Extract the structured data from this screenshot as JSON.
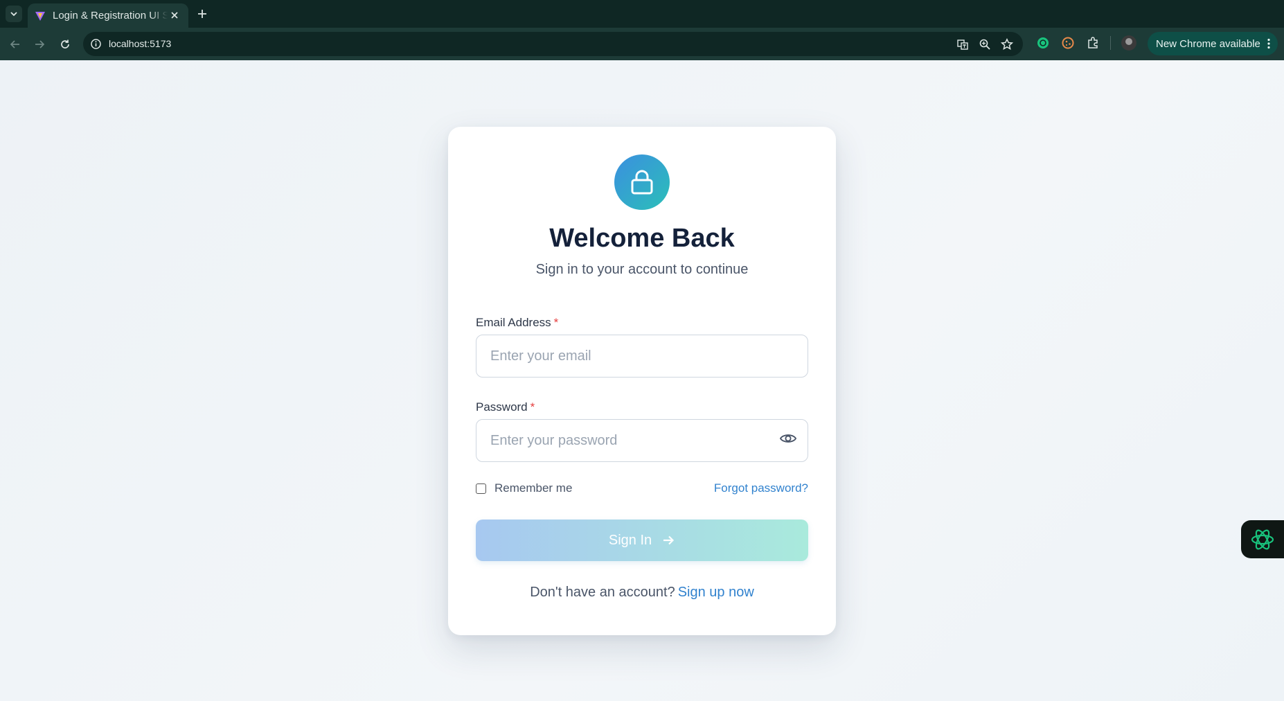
{
  "browser": {
    "tab_title": "Login & Registration UI S",
    "url": "localhost:5173",
    "update_button": "New Chrome available"
  },
  "card": {
    "title": "Welcome Back",
    "subtitle": "Sign in to your account to continue",
    "email": {
      "label": "Email Address",
      "required_mark": "*",
      "placeholder": "Enter your email",
      "value": ""
    },
    "password": {
      "label": "Password",
      "required_mark": "*",
      "placeholder": "Enter your password",
      "value": ""
    },
    "remember_label": "Remember me",
    "remember_checked": false,
    "forgot_label": "Forgot password?",
    "signin_label": "Sign In",
    "signup_prompt": "Don't have an account?",
    "signup_link": "Sign up now"
  },
  "colors": {
    "accent_blue": "#3182ce",
    "gradient_start": "#3b8fe0",
    "gradient_end": "#2bbfb8",
    "required": "#e53e3e",
    "chrome_bg": "#1d3b37"
  },
  "icons": {
    "card_icon": "lock-icon",
    "password_toggle": "eye-icon",
    "signin_arrow": "arrow-right-icon",
    "floating_widget": "openai-icon"
  }
}
